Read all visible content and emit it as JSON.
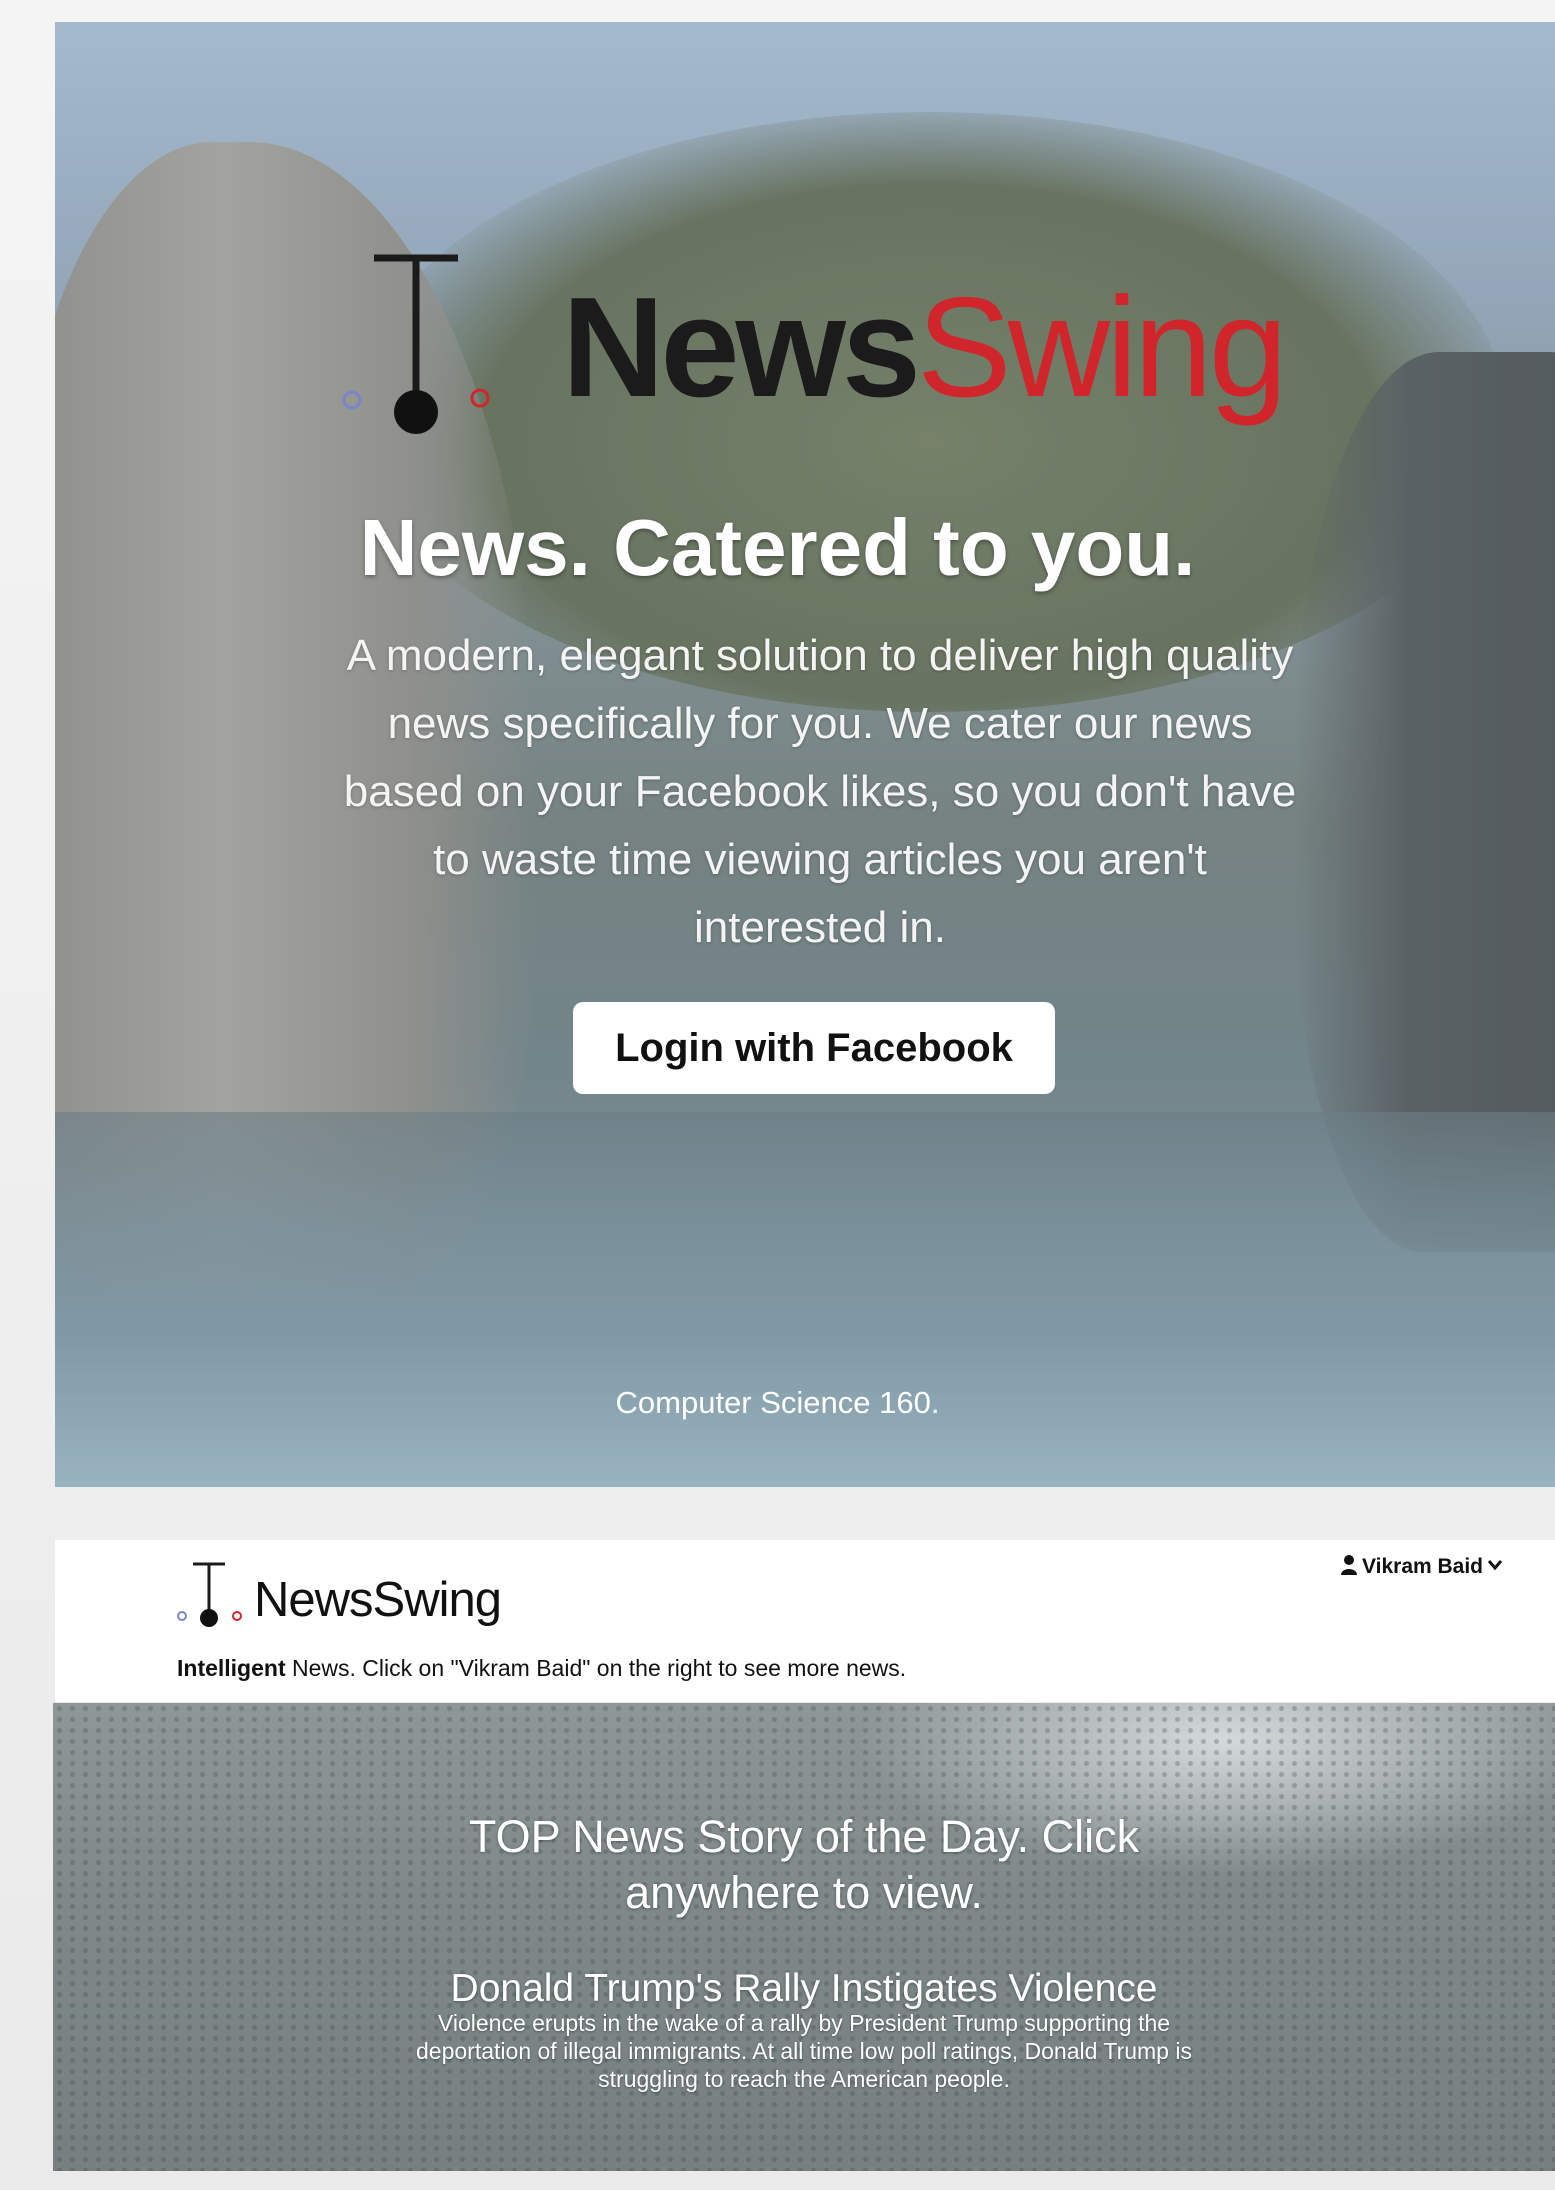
{
  "landing": {
    "brand": {
      "news": "News",
      "swing": "Swing"
    },
    "headline": "News. Catered to you.",
    "description": "A modern, elegant solution to deliver high quality news specifically for you. We cater our news based on your Facebook likes, so you don't have to waste time viewing articles you aren't interested in.",
    "login_button": "Login with Facebook",
    "footer": "Computer Science 160."
  },
  "app": {
    "brand": "NewsSwing",
    "user": {
      "name": "Vikram Baid",
      "icon": "user-icon",
      "caret": "chevron-down-icon"
    },
    "tagline": {
      "bold": "Intelligent",
      "rest": " News. Click on \"Vikram Baid\" on the right to see more news."
    },
    "top_story": {
      "kicker": "TOP News Story of the Day. Click anywhere to view.",
      "title": "Donald Trump's Rally Instigates Violence",
      "summary": "Violence erupts in the wake of a rally by President Trump supporting the deportation of illegal immigrants. At all time low poll ratings, Donald Trump is struggling to reach the American people."
    }
  },
  "colors": {
    "brand_dark": "#1b1b1b",
    "brand_red": "#d0252b",
    "logo_blue_dot": "#7a86c9"
  }
}
